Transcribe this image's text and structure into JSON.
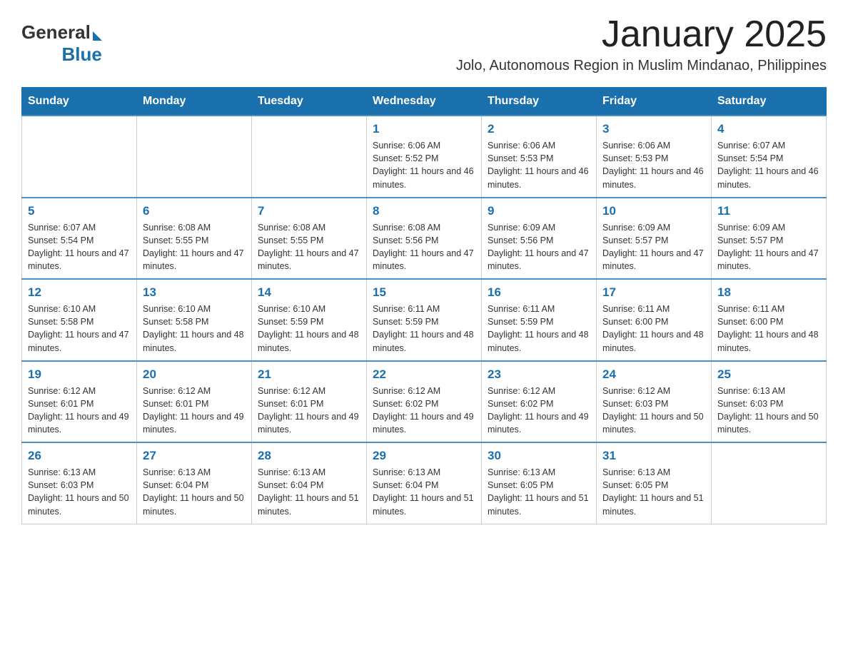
{
  "logo": {
    "text_general": "General",
    "text_blue": "Blue"
  },
  "title": "January 2025",
  "subtitle": "Jolo, Autonomous Region in Muslim Mindanao, Philippines",
  "weekdays": [
    "Sunday",
    "Monday",
    "Tuesday",
    "Wednesday",
    "Thursday",
    "Friday",
    "Saturday"
  ],
  "weeks": [
    [
      {
        "day": "",
        "info": ""
      },
      {
        "day": "",
        "info": ""
      },
      {
        "day": "",
        "info": ""
      },
      {
        "day": "1",
        "info": "Sunrise: 6:06 AM\nSunset: 5:52 PM\nDaylight: 11 hours and 46 minutes."
      },
      {
        "day": "2",
        "info": "Sunrise: 6:06 AM\nSunset: 5:53 PM\nDaylight: 11 hours and 46 minutes."
      },
      {
        "day": "3",
        "info": "Sunrise: 6:06 AM\nSunset: 5:53 PM\nDaylight: 11 hours and 46 minutes."
      },
      {
        "day": "4",
        "info": "Sunrise: 6:07 AM\nSunset: 5:54 PM\nDaylight: 11 hours and 46 minutes."
      }
    ],
    [
      {
        "day": "5",
        "info": "Sunrise: 6:07 AM\nSunset: 5:54 PM\nDaylight: 11 hours and 47 minutes."
      },
      {
        "day": "6",
        "info": "Sunrise: 6:08 AM\nSunset: 5:55 PM\nDaylight: 11 hours and 47 minutes."
      },
      {
        "day": "7",
        "info": "Sunrise: 6:08 AM\nSunset: 5:55 PM\nDaylight: 11 hours and 47 minutes."
      },
      {
        "day": "8",
        "info": "Sunrise: 6:08 AM\nSunset: 5:56 PM\nDaylight: 11 hours and 47 minutes."
      },
      {
        "day": "9",
        "info": "Sunrise: 6:09 AM\nSunset: 5:56 PM\nDaylight: 11 hours and 47 minutes."
      },
      {
        "day": "10",
        "info": "Sunrise: 6:09 AM\nSunset: 5:57 PM\nDaylight: 11 hours and 47 minutes."
      },
      {
        "day": "11",
        "info": "Sunrise: 6:09 AM\nSunset: 5:57 PM\nDaylight: 11 hours and 47 minutes."
      }
    ],
    [
      {
        "day": "12",
        "info": "Sunrise: 6:10 AM\nSunset: 5:58 PM\nDaylight: 11 hours and 47 minutes."
      },
      {
        "day": "13",
        "info": "Sunrise: 6:10 AM\nSunset: 5:58 PM\nDaylight: 11 hours and 48 minutes."
      },
      {
        "day": "14",
        "info": "Sunrise: 6:10 AM\nSunset: 5:59 PM\nDaylight: 11 hours and 48 minutes."
      },
      {
        "day": "15",
        "info": "Sunrise: 6:11 AM\nSunset: 5:59 PM\nDaylight: 11 hours and 48 minutes."
      },
      {
        "day": "16",
        "info": "Sunrise: 6:11 AM\nSunset: 5:59 PM\nDaylight: 11 hours and 48 minutes."
      },
      {
        "day": "17",
        "info": "Sunrise: 6:11 AM\nSunset: 6:00 PM\nDaylight: 11 hours and 48 minutes."
      },
      {
        "day": "18",
        "info": "Sunrise: 6:11 AM\nSunset: 6:00 PM\nDaylight: 11 hours and 48 minutes."
      }
    ],
    [
      {
        "day": "19",
        "info": "Sunrise: 6:12 AM\nSunset: 6:01 PM\nDaylight: 11 hours and 49 minutes."
      },
      {
        "day": "20",
        "info": "Sunrise: 6:12 AM\nSunset: 6:01 PM\nDaylight: 11 hours and 49 minutes."
      },
      {
        "day": "21",
        "info": "Sunrise: 6:12 AM\nSunset: 6:01 PM\nDaylight: 11 hours and 49 minutes."
      },
      {
        "day": "22",
        "info": "Sunrise: 6:12 AM\nSunset: 6:02 PM\nDaylight: 11 hours and 49 minutes."
      },
      {
        "day": "23",
        "info": "Sunrise: 6:12 AM\nSunset: 6:02 PM\nDaylight: 11 hours and 49 minutes."
      },
      {
        "day": "24",
        "info": "Sunrise: 6:12 AM\nSunset: 6:03 PM\nDaylight: 11 hours and 50 minutes."
      },
      {
        "day": "25",
        "info": "Sunrise: 6:13 AM\nSunset: 6:03 PM\nDaylight: 11 hours and 50 minutes."
      }
    ],
    [
      {
        "day": "26",
        "info": "Sunrise: 6:13 AM\nSunset: 6:03 PM\nDaylight: 11 hours and 50 minutes."
      },
      {
        "day": "27",
        "info": "Sunrise: 6:13 AM\nSunset: 6:04 PM\nDaylight: 11 hours and 50 minutes."
      },
      {
        "day": "28",
        "info": "Sunrise: 6:13 AM\nSunset: 6:04 PM\nDaylight: 11 hours and 51 minutes."
      },
      {
        "day": "29",
        "info": "Sunrise: 6:13 AM\nSunset: 6:04 PM\nDaylight: 11 hours and 51 minutes."
      },
      {
        "day": "30",
        "info": "Sunrise: 6:13 AM\nSunset: 6:05 PM\nDaylight: 11 hours and 51 minutes."
      },
      {
        "day": "31",
        "info": "Sunrise: 6:13 AM\nSunset: 6:05 PM\nDaylight: 11 hours and 51 minutes."
      },
      {
        "day": "",
        "info": ""
      }
    ]
  ]
}
